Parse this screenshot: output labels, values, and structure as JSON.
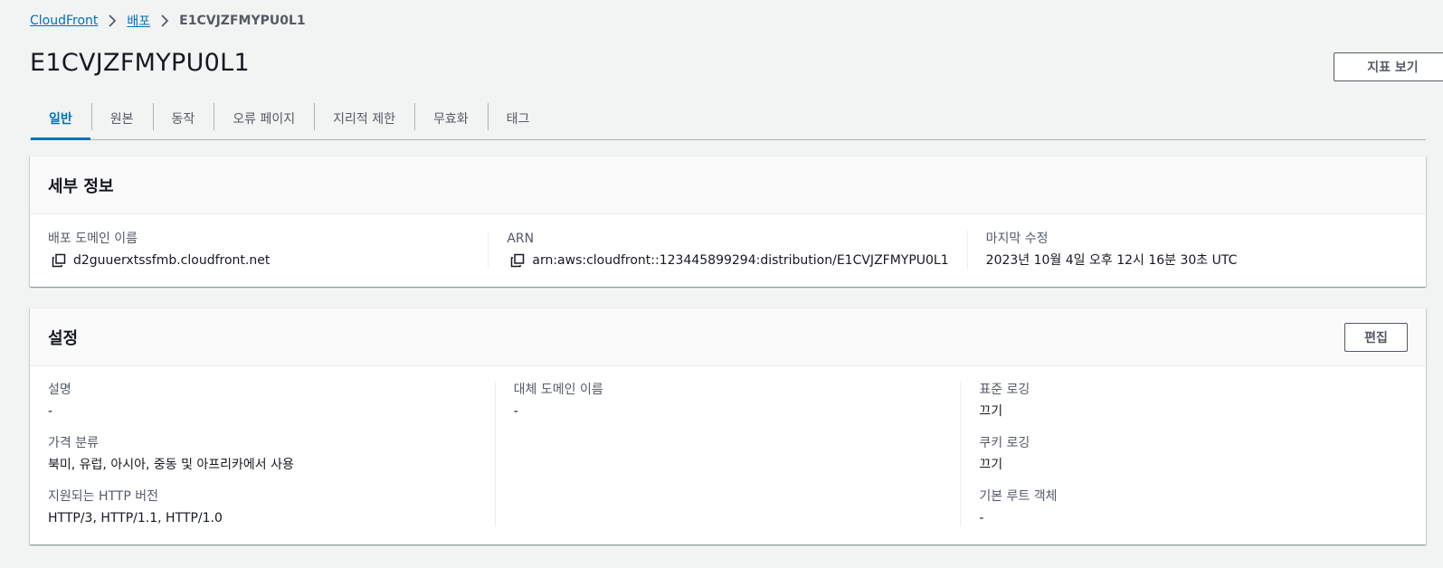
{
  "breadcrumb": {
    "root": "CloudFront",
    "section": "배포",
    "current": "E1CVJZFMYPU0L1"
  },
  "header": {
    "title": "E1CVJZFMYPU0L1",
    "metrics_button": "지표 보기"
  },
  "tabs": [
    {
      "label": "일반",
      "active": true
    },
    {
      "label": "원본"
    },
    {
      "label": "동작"
    },
    {
      "label": "오류 페이지"
    },
    {
      "label": "지리적 제한"
    },
    {
      "label": "무효화"
    },
    {
      "label": "태그"
    }
  ],
  "details": {
    "title": "세부 정보",
    "domain_label": "배포 도메인 이름",
    "domain_value": "d2guuerxtssfmb.cloudfront.net",
    "arn_label": "ARN",
    "arn_value": "arn:aws:cloudfront::123445899294:distribution/E1CVJZFMYPU0L1",
    "modified_label": "마지막 수정",
    "modified_value": "2023년 10월 4일 오후 12시 16분 30초 UTC"
  },
  "settings": {
    "title": "설정",
    "edit_button": "편집",
    "description_label": "설명",
    "description_value": "-",
    "price_class_label": "가격 분류",
    "price_class_value": "북미, 유럽, 아시아, 중동 및 아프리카에서 사용",
    "http_label": "지원되는 HTTP 버전",
    "http_value": "HTTP/3, HTTP/1.1, HTTP/1.0",
    "alt_domain_label": "대체 도메인 이름",
    "alt_domain_value": "-",
    "std_logging_label": "표준 로깅",
    "std_logging_value": "끄기",
    "cookie_logging_label": "쿠키 로깅",
    "cookie_logging_value": "끄기",
    "root_object_label": "기본 루트 객체",
    "root_object_value": "-"
  },
  "colors": {
    "link": "#0073bb",
    "text": "#16191f",
    "label": "#545b64",
    "background": "#f2f3f3"
  },
  "icons": [
    "chevron-right-icon",
    "copy-icon"
  ]
}
